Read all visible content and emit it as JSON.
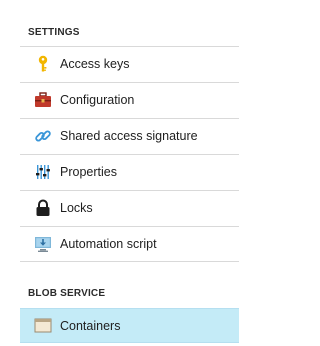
{
  "settings": {
    "header": "SETTINGS",
    "items": [
      {
        "label": "Access keys",
        "icon": "key-icon"
      },
      {
        "label": "Configuration",
        "icon": "toolbox-icon"
      },
      {
        "label": "Shared access signature",
        "icon": "link-icon"
      },
      {
        "label": "Properties",
        "icon": "sliders-icon"
      },
      {
        "label": "Locks",
        "icon": "lock-icon"
      },
      {
        "label": "Automation script",
        "icon": "monitor-download-icon"
      }
    ]
  },
  "blob_service": {
    "header": "BLOB SERVICE",
    "items": [
      {
        "label": "Containers",
        "icon": "container-icon",
        "selected": true
      }
    ]
  },
  "colors": {
    "selected_background": "#c4ebf7",
    "divider": "#d9d9d9",
    "key_yellow": "#f2b600",
    "toolbox_red": "#c0392b",
    "link_blue": "#3a96d8",
    "lock_dark": "#1e1e1e"
  }
}
